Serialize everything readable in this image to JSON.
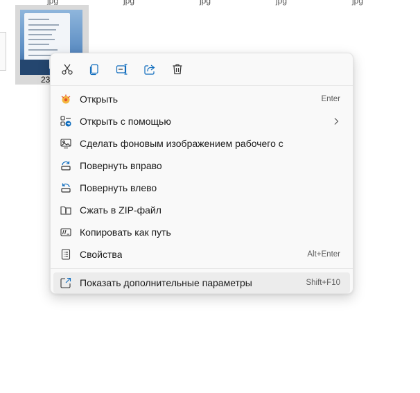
{
  "top_labels": [
    "jpg",
    "jpg",
    "jpg",
    "jpg",
    "jpg"
  ],
  "file": {
    "name": "23"
  },
  "toolbar": {
    "cut": "cut-icon",
    "copy": "copy-icon",
    "rename": "rename-icon",
    "share": "share-icon",
    "delete": "delete-icon"
  },
  "menu": {
    "items": [
      {
        "label": "Открыть",
        "shortcut": "Enter",
        "icon": "open-photos-icon"
      },
      {
        "label": "Открыть с помощью",
        "shortcut": "",
        "icon": "open-with-icon",
        "submenu": true
      },
      {
        "label": "Сделать фоновым изображением рабочего стола",
        "shortcut": "",
        "icon": "wallpaper-icon"
      },
      {
        "label": "Повернуть вправо",
        "shortcut": "",
        "icon": "rotate-right-icon"
      },
      {
        "label": "Повернуть влево",
        "shortcut": "",
        "icon": "rotate-left-icon"
      },
      {
        "label": "Сжать в ZIP-файл",
        "shortcut": "",
        "icon": "zip-icon"
      },
      {
        "label": "Копировать как путь",
        "shortcut": "",
        "icon": "copy-path-icon"
      },
      {
        "label": "Свойства",
        "shortcut": "Alt+Enter",
        "icon": "properties-icon"
      }
    ],
    "more": {
      "label": "Показать дополнительные параметры",
      "shortcut": "Shift+F10",
      "icon": "more-options-icon"
    }
  },
  "colors": {
    "accent": "#0078d4",
    "menu_bg": "#f9f9f9",
    "selected_tile": "#d9d9d9"
  }
}
